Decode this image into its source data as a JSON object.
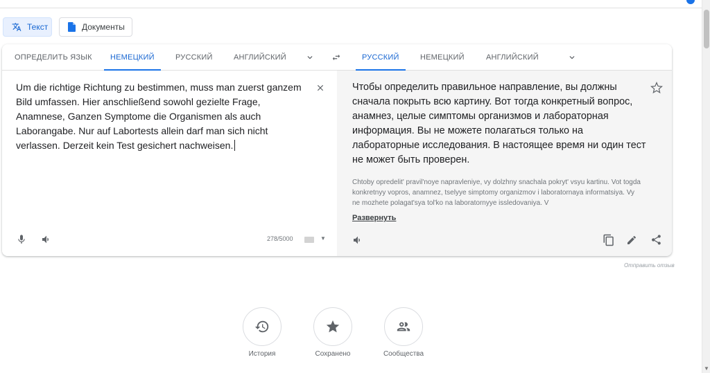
{
  "mode_tabs": [
    {
      "label": "Текст",
      "icon": "translate-icon"
    },
    {
      "label": "Документы",
      "icon": "document-icon"
    }
  ],
  "source_langs": [
    "ОПРЕДЕЛИТЬ ЯЗЫК",
    "НЕМЕЦКИЙ",
    "РУССКИЙ",
    "АНГЛИЙСКИЙ"
  ],
  "source_active": "НЕМЕЦКИЙ",
  "target_langs": [
    "РУССКИЙ",
    "НЕМЕЦКИЙ",
    "АНГЛИЙСКИЙ"
  ],
  "target_active": "РУССКИЙ",
  "source_text": "Um die richtige Richtung zu bestimmen, muss man zuerst ganzem Bild umfassen. Hier anschließend sowohl gezielte Frage, Anamnese, Ganzen Symptome die Organismen als auch Laborangabe. Nur auf Labortests allein darf man sich nicht verlassen. Derzeit kein Test gesichert nachweisen.",
  "translation_text": "Чтобы определить правильное направление, вы должны сначала покрыть всю картину. Вот тогда конкретный вопрос, анамнез, целые симптомы организмов и лабораторная информация. Вы не можете полагаться только на лабораторные исследования. В настоящее время ни один тест не может быть проверен.",
  "transliteration": "Chtoby opredelit' pravil'noye napravleniye, vy dolzhny snachala pokryt' vsyu kartinu. Vot togda konkretnyy vopros, anamnez, tselyye simptomy organizmov i laboratornaya informatsiya. Vy ne mozhete polagat'sya tol'ko na laboratornyye issledovaniya. V",
  "expand_label": "Развернуть",
  "char_counter": "278/5000",
  "feedback_label": "Отправить отзыв",
  "bottom_actions": [
    {
      "label": "История",
      "icon": "history-icon"
    },
    {
      "label": "Сохранено",
      "icon": "star-icon"
    },
    {
      "label": "Сообщества",
      "icon": "community-icon"
    }
  ],
  "colors": {
    "accent": "#1a73e8",
    "target_bg": "#f5f5f5"
  }
}
